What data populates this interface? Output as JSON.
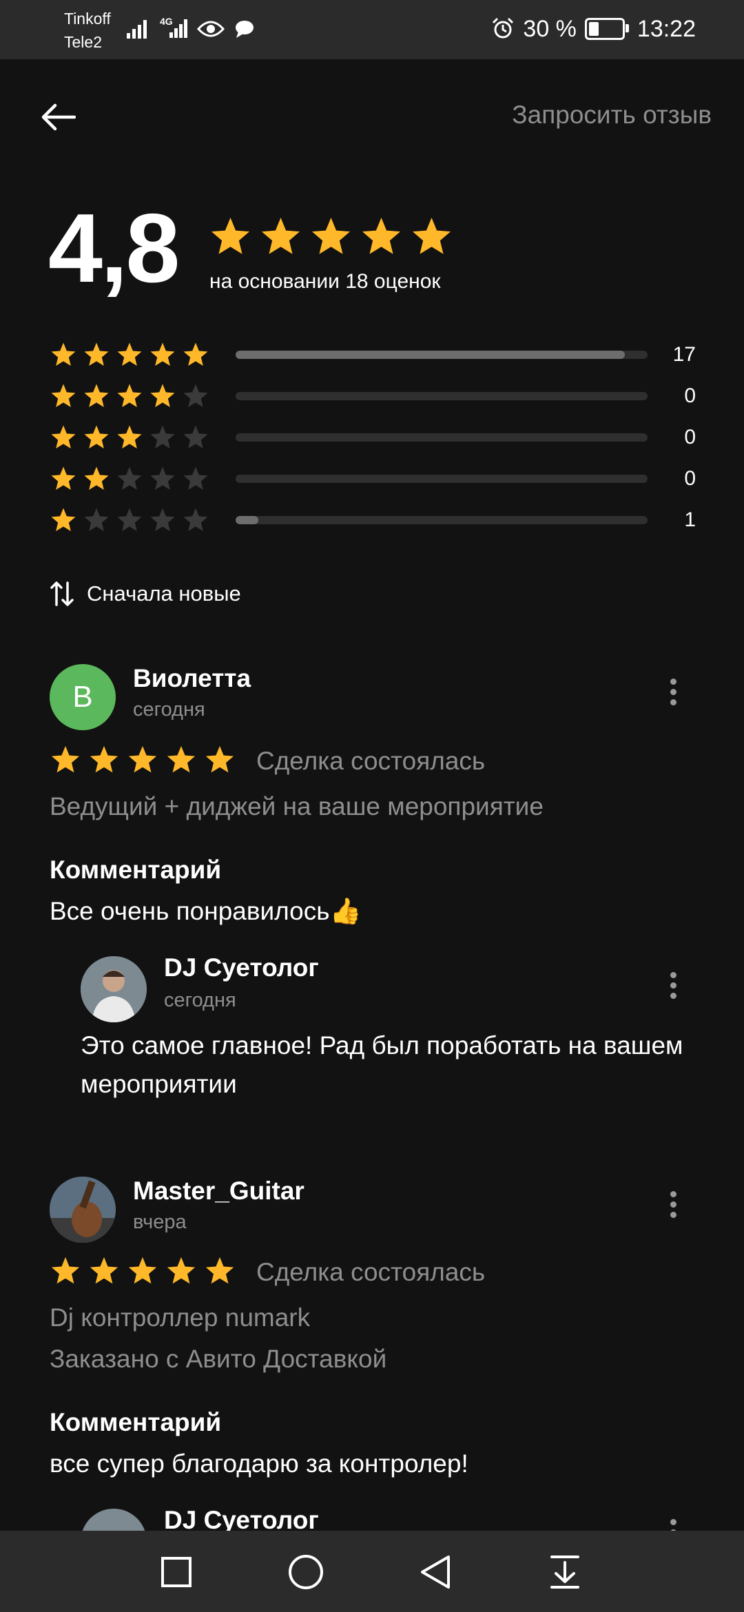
{
  "status_bar": {
    "carrier_1": "Tinkoff",
    "carrier_2": "Tele2",
    "network": "4G",
    "battery": "30 %",
    "battery_level": 0.3,
    "time": "13:22"
  },
  "header": {
    "request_review": "Запросить отзыв"
  },
  "summary": {
    "rating": "4,8",
    "stars": 5,
    "based_on": "на основании 18 оценок",
    "distribution": [
      {
        "stars": 5,
        "count": "17",
        "fraction": 0.944
      },
      {
        "stars": 4,
        "count": "0",
        "fraction": 0
      },
      {
        "stars": 3,
        "count": "0",
        "fraction": 0
      },
      {
        "stars": 2,
        "count": "0",
        "fraction": 0
      },
      {
        "stars": 1,
        "count": "1",
        "fraction": 0.056
      }
    ]
  },
  "sort": {
    "label": "Сначала новые"
  },
  "reviews": [
    {
      "avatar_letter": "В",
      "name": "Виолетта",
      "date": "сегодня",
      "stars": 5,
      "status": "Сделка состоялась",
      "item": "Ведущий + диджей на ваше мероприятие",
      "comment_heading": "Комментарий",
      "comment": "Все очень понравилось👍",
      "reply": {
        "name": "DJ Суетолог",
        "date": "сегодня",
        "text": "Это самое главное! Рад был поработать на вашем мероприятии"
      }
    },
    {
      "name": "Master_Guitar",
      "date": "вчера",
      "stars": 5,
      "status": "Сделка состоялась",
      "item": "Dj контроллер numark",
      "delivery": "Заказано с Авито Доставкой",
      "comment_heading": "Комментарий",
      "comment": "все супер  благодарю за контролер!",
      "reply": {
        "name": "DJ Суетолог"
      }
    }
  ],
  "colors": {
    "background": "#121212",
    "star": "#ffb829",
    "star_empty": "#3a3a3a",
    "muted_text": "#8e8e8e",
    "avatar_green": "#5cb85c"
  }
}
